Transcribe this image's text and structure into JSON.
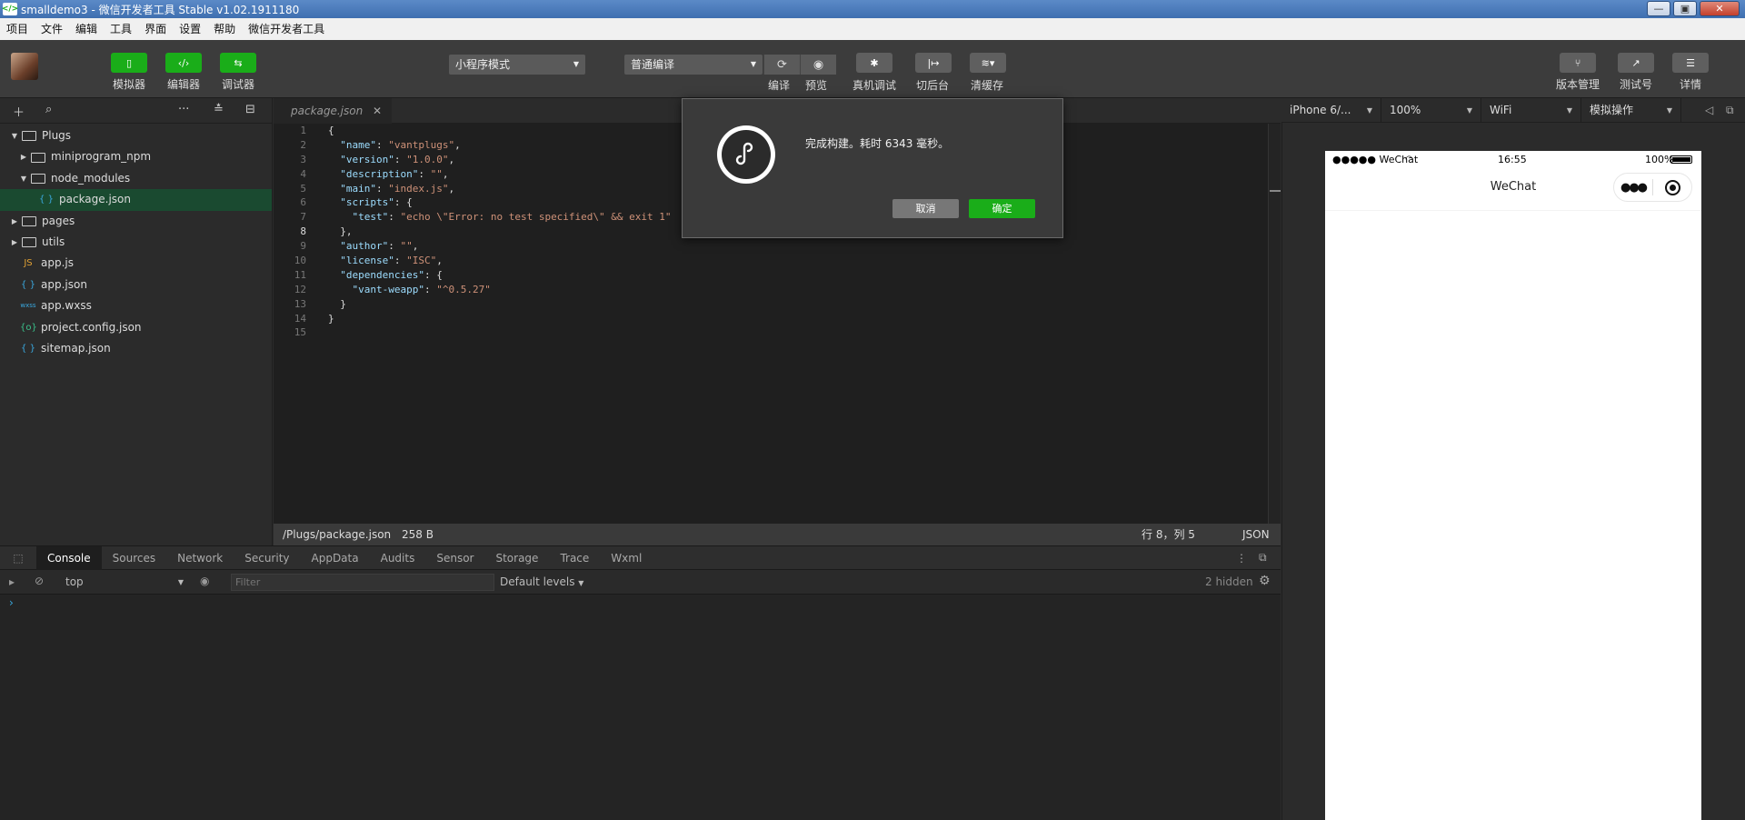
{
  "window": {
    "title": "smalldemo3 - 微信开发者工具 Stable v1.02.1911180",
    "min": "—",
    "max": "▣",
    "close": "✕"
  },
  "menu": [
    "项目",
    "文件",
    "编辑",
    "工具",
    "界面",
    "设置",
    "帮助",
    "微信开发者工具"
  ],
  "toolbar": {
    "simulator": "模拟器",
    "editor": "编辑器",
    "debugger": "调试器",
    "mode": "小程序模式",
    "compile_mode": "普通编译",
    "compile": "编译",
    "preview": "预览",
    "real_debug": "真机调试",
    "background": "切后台",
    "clear_cache": "清缓存",
    "version": "版本管理",
    "test": "测试号",
    "details": "详情"
  },
  "sidebar": {
    "tree": [
      {
        "label": "Plugs",
        "kind": "folder",
        "open": true,
        "depth": 0
      },
      {
        "label": "miniprogram_npm",
        "kind": "folder",
        "open": false,
        "depth": 1
      },
      {
        "label": "node_modules",
        "kind": "folder",
        "open": true,
        "depth": 1
      },
      {
        "label": "package.json",
        "kind": "json",
        "depth": 2,
        "selected": true
      },
      {
        "label": "pages",
        "kind": "folder",
        "open": false,
        "depth": 0
      },
      {
        "label": "utils",
        "kind": "folder",
        "open": false,
        "depth": 0
      },
      {
        "label": "app.js",
        "kind": "js",
        "depth": 0
      },
      {
        "label": "app.json",
        "kind": "json",
        "depth": 0
      },
      {
        "label": "app.wxss",
        "kind": "wxss",
        "depth": 0
      },
      {
        "label": "project.config.json",
        "kind": "cfg",
        "depth": 0
      },
      {
        "label": "sitemap.json",
        "kind": "json",
        "depth": 0
      }
    ]
  },
  "editor": {
    "tab": "package.json",
    "current_line": 8,
    "lines": [
      [
        {
          "t": "p",
          "v": "{"
        }
      ],
      [
        {
          "t": "p",
          "v": "  "
        },
        {
          "t": "k",
          "v": "\"name\""
        },
        {
          "t": "p",
          "v": ": "
        },
        {
          "t": "s",
          "v": "\"vantplugs\""
        },
        {
          "t": "p",
          "v": ","
        }
      ],
      [
        {
          "t": "p",
          "v": "  "
        },
        {
          "t": "k",
          "v": "\"version\""
        },
        {
          "t": "p",
          "v": ": "
        },
        {
          "t": "s",
          "v": "\"1.0.0\""
        },
        {
          "t": "p",
          "v": ","
        }
      ],
      [
        {
          "t": "p",
          "v": "  "
        },
        {
          "t": "k",
          "v": "\"description\""
        },
        {
          "t": "p",
          "v": ": "
        },
        {
          "t": "s",
          "v": "\"\""
        },
        {
          "t": "p",
          "v": ","
        }
      ],
      [
        {
          "t": "p",
          "v": "  "
        },
        {
          "t": "k",
          "v": "\"main\""
        },
        {
          "t": "p",
          "v": ": "
        },
        {
          "t": "s",
          "v": "\"index.js\""
        },
        {
          "t": "p",
          "v": ","
        }
      ],
      [
        {
          "t": "p",
          "v": "  "
        },
        {
          "t": "k",
          "v": "\"scripts\""
        },
        {
          "t": "p",
          "v": ": {"
        }
      ],
      [
        {
          "t": "p",
          "v": "    "
        },
        {
          "t": "k",
          "v": "\"test\""
        },
        {
          "t": "p",
          "v": ": "
        },
        {
          "t": "s",
          "v": "\"echo \\\"Error: no test specified\\\" && exit 1\""
        }
      ],
      [
        {
          "t": "p",
          "v": "  },"
        }
      ],
      [
        {
          "t": "p",
          "v": "  "
        },
        {
          "t": "k",
          "v": "\"author\""
        },
        {
          "t": "p",
          "v": ": "
        },
        {
          "t": "s",
          "v": "\"\""
        },
        {
          "t": "p",
          "v": ","
        }
      ],
      [
        {
          "t": "p",
          "v": "  "
        },
        {
          "t": "k",
          "v": "\"license\""
        },
        {
          "t": "p",
          "v": ": "
        },
        {
          "t": "s",
          "v": "\"ISC\""
        },
        {
          "t": "p",
          "v": ","
        }
      ],
      [
        {
          "t": "p",
          "v": "  "
        },
        {
          "t": "k",
          "v": "\"dependencies\""
        },
        {
          "t": "p",
          "v": ": {"
        }
      ],
      [
        {
          "t": "p",
          "v": "    "
        },
        {
          "t": "k",
          "v": "\"vant-weapp\""
        },
        {
          "t": "p",
          "v": ": "
        },
        {
          "t": "s",
          "v": "\"^0.5.27\""
        }
      ],
      [
        {
          "t": "p",
          "v": "  }"
        }
      ],
      [
        {
          "t": "p",
          "v": "}"
        }
      ],
      [
        {
          "t": "p",
          "v": ""
        }
      ]
    ]
  },
  "statusbar": {
    "path": "/Plugs/package.json",
    "size": "258 B",
    "position": "行 8，列 5",
    "lang": "JSON"
  },
  "devtools": {
    "tabs": [
      "Console",
      "Sources",
      "Network",
      "Security",
      "AppData",
      "Audits",
      "Sensor",
      "Storage",
      "Trace",
      "Wxml"
    ],
    "active": "Console",
    "context": "top",
    "filter_placeholder": "Filter",
    "levels": "Default levels",
    "hidden": "2 hidden"
  },
  "sim": {
    "device": "iPhone 6/...",
    "zoom": "100%",
    "network": "WiFi",
    "action": "模拟操作",
    "carrier": "●●●●● WeChat",
    "time": "16:55",
    "battery": "100%",
    "nav_title": "WeChat"
  },
  "modal": {
    "message": "完成构建。耗时 6343 毫秒。",
    "cancel": "取消",
    "ok": "确定"
  }
}
